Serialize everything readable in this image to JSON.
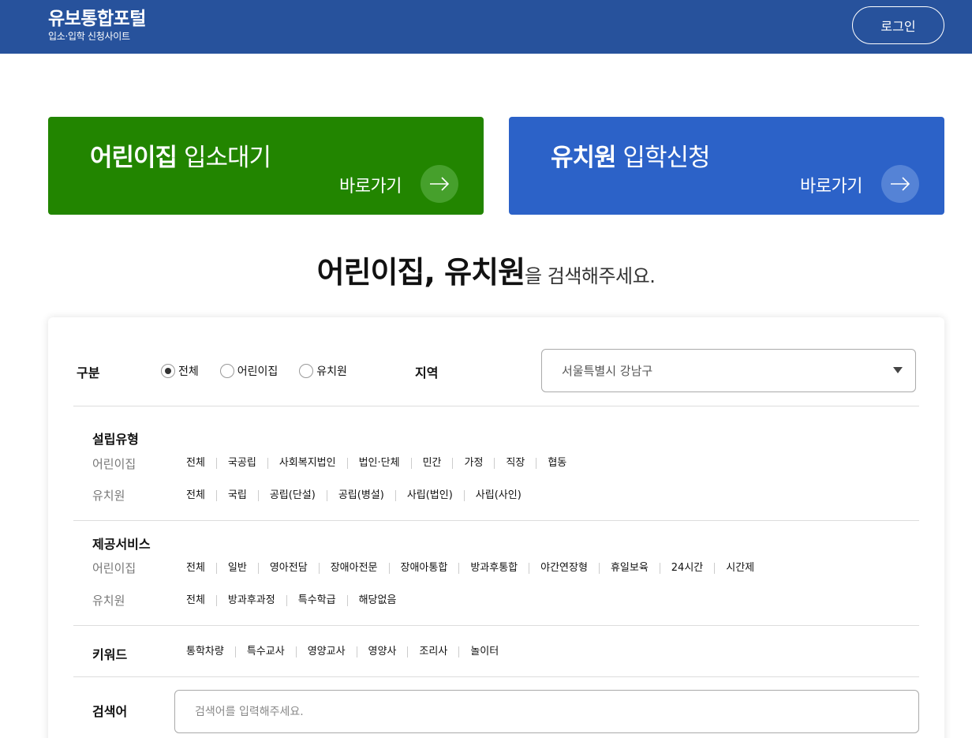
{
  "header": {
    "title": "유보통합포털",
    "subtitle": "입소·입학 신청사이트",
    "login_label": "로그인"
  },
  "cards": [
    {
      "bold": "어린이집",
      "light": "입소대기",
      "go": "바로가기",
      "color": "#228500"
    },
    {
      "bold": "유치원",
      "light": "입학신청",
      "go": "바로가기",
      "color": "#2c62c8"
    }
  ],
  "search_heading": {
    "strong": "어린이집, 유치원",
    "rest": "을 검색해주세요."
  },
  "filters": {
    "category_label": "구분",
    "category_options": [
      {
        "label": "전체",
        "checked": true
      },
      {
        "label": "어린이집",
        "checked": false
      },
      {
        "label": "유치원",
        "checked": false
      }
    ],
    "region_label": "지역",
    "region_value": "서울특별시 강남구",
    "establishment": {
      "title": "설립유형",
      "daycare_label": "어린이집",
      "daycare_options": [
        "전체",
        "국공립",
        "사회복지법인",
        "법인·단체",
        "민간",
        "가정",
        "직장",
        "협동"
      ],
      "kinder_label": "유치원",
      "kinder_options": [
        "전체",
        "국립",
        "공립(단설)",
        "공립(병설)",
        "사립(법인)",
        "사립(사인)"
      ]
    },
    "services": {
      "title": "제공서비스",
      "daycare_label": "어린이집",
      "daycare_options": [
        "전체",
        "일반",
        "영아전담",
        "장애아전문",
        "장애아통합",
        "방과후통합",
        "야간연장형",
        "휴일보육",
        "24시간",
        "시간제"
      ],
      "kinder_label": "유치원",
      "kinder_options": [
        "전체",
        "방과후과정",
        "특수학급",
        "해당없음"
      ]
    },
    "keyword": {
      "title": "키워드",
      "options": [
        "통학차량",
        "특수교사",
        "영양교사",
        "영양사",
        "조리사",
        "놀이터"
      ]
    },
    "search": {
      "label": "검색어",
      "placeholder": "검색어를 입력해주세요."
    }
  },
  "colors": {
    "header": "#27529c",
    "green": "#228500",
    "blue": "#2c62c8"
  }
}
